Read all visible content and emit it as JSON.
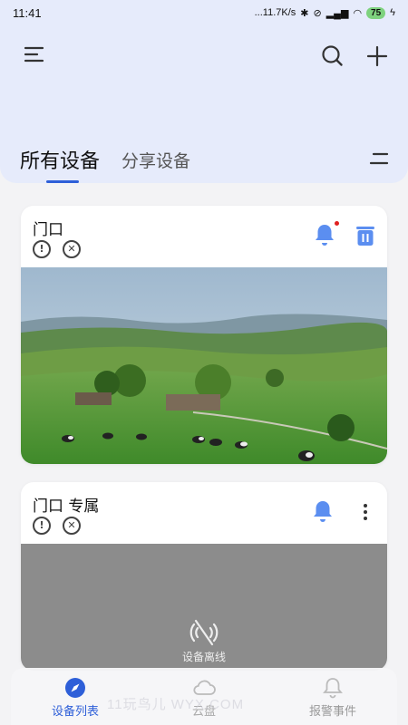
{
  "status_bar": {
    "time": "11:41",
    "network_speed": "...11.7K/s",
    "battery": "75"
  },
  "header": {
    "menu_icon": "menu-icon",
    "search_icon": "search-icon",
    "add_icon": "plus-icon",
    "tabs": [
      {
        "label": "所有设备",
        "active": true
      },
      {
        "label": "分享设备",
        "active": false
      }
    ],
    "filter_icon": "filter-icon"
  },
  "devices": [
    {
      "name": "门口",
      "status_icons": [
        "info-icon",
        "close-circle-icon"
      ],
      "alarm_icon": "bell-icon",
      "has_notification_dot": true,
      "action_icon": "trash-icon",
      "state": "online"
    },
    {
      "name": "门口 专属",
      "status_icons": [
        "info-icon",
        "close-circle-icon"
      ],
      "alarm_icon": "bell-icon",
      "action_icon": "more-vertical-icon",
      "state": "offline",
      "offline_label": "设备离线"
    }
  ],
  "bottom_nav": [
    {
      "label": "设备列表",
      "icon": "compass-icon",
      "active": true
    },
    {
      "label": "云盘",
      "icon": "cloud-icon",
      "active": false
    },
    {
      "label": "报警事件",
      "icon": "bell-icon",
      "active": false
    }
  ],
  "watermark": "11玩鸟儿 WYX.COM",
  "colors": {
    "accent": "#2e5fd8",
    "bell": "#5b8ef0",
    "header_bg": "#e6ebfb",
    "offline_bg": "#8c8c8c"
  }
}
